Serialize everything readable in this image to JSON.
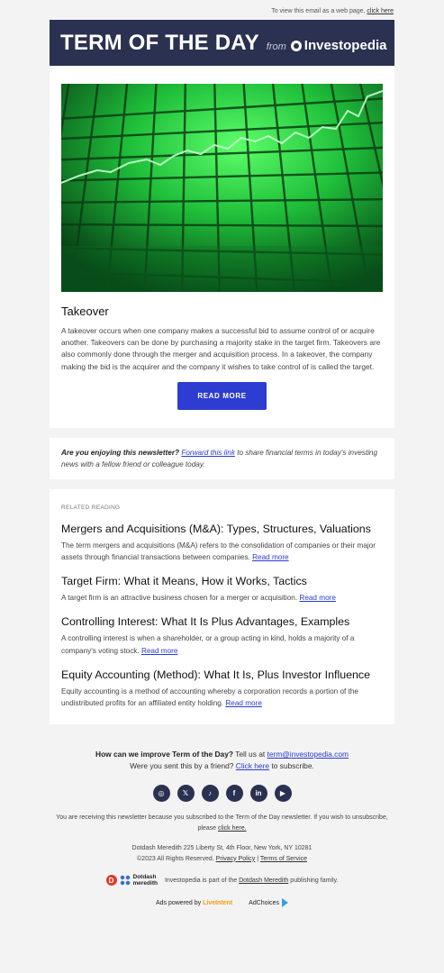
{
  "topline": {
    "text": "To view this email as a web page,",
    "link": "click here"
  },
  "header": {
    "title": "TERM OF THE DAY",
    "from": "from",
    "brand": "Investopedia"
  },
  "main": {
    "term": "Takeover",
    "description": "A takeover occurs when one company makes a successful bid to assume control of or acquire another. Takeovers can be done by purchasing a majority stake in the target firm. Takeovers are also commonly done through the merger and acquisition process. In a takeover, the company making the bid is the acquirer and the company it wishes to take control of is called the target.",
    "button": "READ MORE"
  },
  "share": {
    "question": "Are you enjoying this newsletter?",
    "link": "Forward this link",
    "rest": "to share financial terms in today's investing news with a fellow friend or colleague today."
  },
  "related": {
    "kicker": "RELATED READING",
    "read_more": "Read more",
    "items": [
      {
        "title": "Mergers and Acquisitions (M&A): Types, Structures, Valuations",
        "desc": "The term mergers and acquisitions (M&A) refers to the consolidation of companies or their major assets through financial transactions between companies."
      },
      {
        "title": "Target Firm: What it Means, How it Works, Tactics",
        "desc": "A target firm is an attractive business chosen for a merger or acquisition."
      },
      {
        "title": "Controlling Interest: What It Is Plus Advantages, Examples",
        "desc": "A controlling interest is when a shareholder, or a group acting in kind, holds a majority of a company's voting stock."
      },
      {
        "title": "Equity Accounting (Method): What It Is, Plus Investor Influence",
        "desc": "Equity accounting is a method of accounting whereby a corporation records a portion of the undistributed profits for an affiliated entity holding."
      }
    ]
  },
  "footer": {
    "improve_bold": "How can we improve Term of the Day?",
    "improve_text": "Tell us at",
    "email": "term@investopedia.com",
    "friend_text": "Were you sent this by a friend?",
    "friend_link": "Click here",
    "friend_rest": "to subscribe.",
    "social": [
      "instagram-icon",
      "x-icon",
      "tiktok-icon",
      "facebook-icon",
      "linkedin-icon",
      "youtube-icon"
    ],
    "social_glyphs": [
      "◎",
      "𝕏",
      "♪",
      "f",
      "in",
      "▶"
    ],
    "unsub_text": "You are receiving this newsletter because you subscribed to the Term of the Day newsletter. If you wish to unsubscribe, please",
    "unsub_link": "click here.",
    "address": "Dotdash Meredith 225 Liberty St, 4th Floor, New York, NY 10281",
    "copyright": "©2023 All Rights Reserved.",
    "privacy": "Privacy Policy",
    "terms": "Terms of Service",
    "dd_name_1": "Dotdash",
    "dd_name_2": "meredith",
    "family_text_1": "Investopedia is part of the",
    "family_link": "Dotdash Meredith",
    "family_text_2": "publishing family.",
    "ads_powered": "Ads powered by",
    "liveintent": "LiveIntent",
    "adchoices": "AdChoices"
  },
  "colors": {
    "header_bg": "#2b3150",
    "button": "#2d3dd1",
    "link": "#2a3bd1"
  }
}
